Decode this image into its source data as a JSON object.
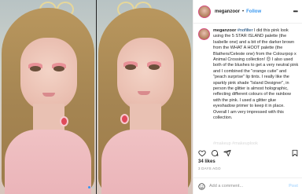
{
  "post": {
    "username": "meganzoor",
    "separator": "•",
    "follow_label": "Follow",
    "more_icon": "more-horizontal-icon"
  },
  "caption": {
    "username": "meganzoor",
    "hashtag": "#nofilter",
    "body": "I did this pink look using the 5 STAR ISLAND palette (the Isabelle one) and a bit of the darker brown from the WHAT A HOOT palette (the Blathers/Celeste one) from the Colourpop x Animal Crossing collection! 😊 I also used both of the blushes to get a very neutral pink and I combined the \"orange cutie\" and \"peach surprise\" lip tints. I really like the sparkly pink shade \"Island Designer\", in person the glitter is almost holographic, reflecting different colours of the rainbow with the pink. I used a glitter glue eyeshadow primer to keep it in place. Overall I am very impressed with this collection.",
    "faded_line": "#makeup #makeuplook"
  },
  "actions": {
    "like_icon": "heart-icon",
    "comment_icon": "comment-icon",
    "share_icon": "share-icon",
    "save_icon": "bookmark-icon"
  },
  "likes": "34 likes",
  "time_ago": "3 DAYS AGO",
  "comment_box": {
    "emoji_icon": "smiley-icon",
    "placeholder": "Add a comment...",
    "post_label": "Post"
  },
  "carousel": {
    "dot_count": 2,
    "active_index": 1
  },
  "colors": {
    "link_blue": "#3897f0",
    "text": "#262626",
    "muted": "#8e8e8e"
  }
}
